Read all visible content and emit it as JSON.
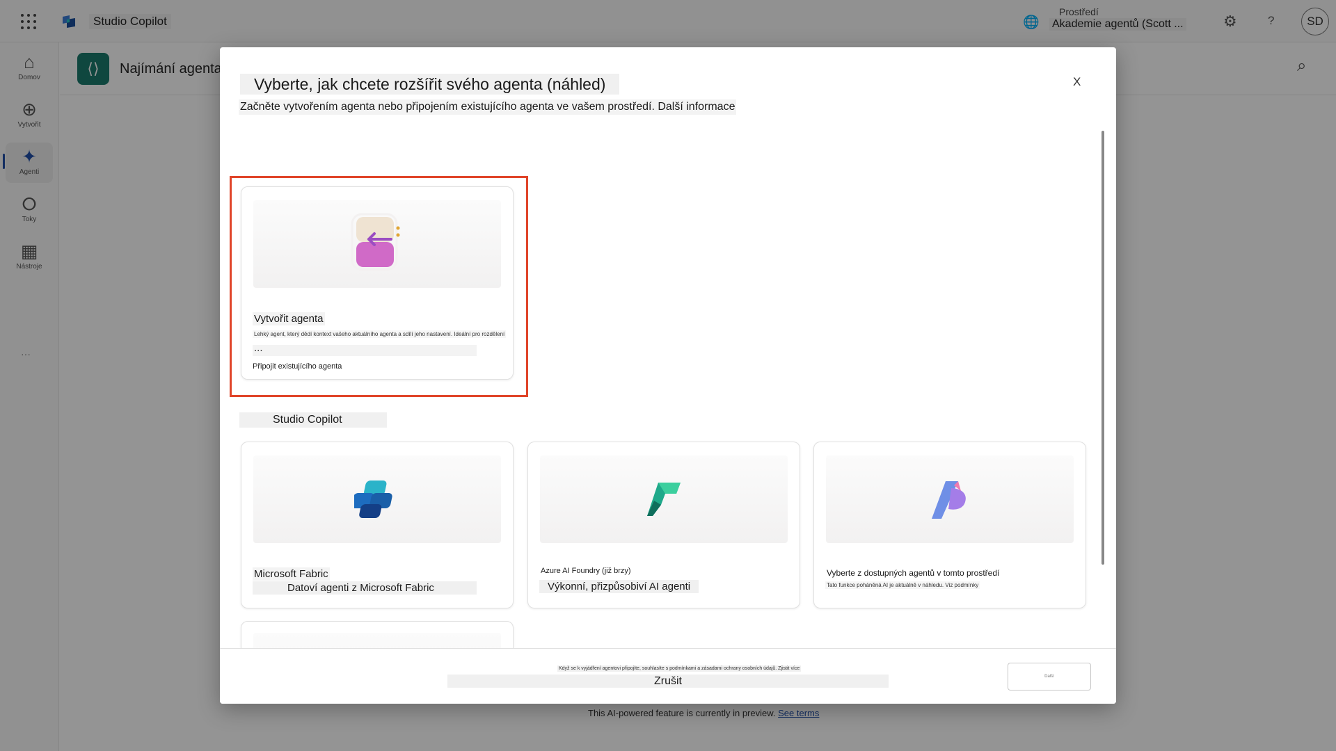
{
  "app": {
    "name": "Studio Copilot",
    "environment_label": "Prostředí",
    "environment_name": "Akademie agentů (Scott ...",
    "user_initials": "SD"
  },
  "nav": {
    "items": [
      {
        "label": "Domov",
        "icon": "home-icon"
      },
      {
        "label": "Vytvořit",
        "icon": "create-icon"
      },
      {
        "label": "Agenti",
        "icon": "agents-icon"
      },
      {
        "label": "Toky",
        "icon": "flows-icon"
      },
      {
        "label": "Nástroje",
        "icon": "tools-icon"
      }
    ],
    "more": "···"
  },
  "page": {
    "title": "Najímání agenta"
  },
  "dialog": {
    "title": "Vyberte, jak chcete rozšířit svého agenta (náhled)",
    "subtitle": "Začněte vytvořením agenta nebo připojením existujícího agenta ve vašem prostředí. Další informace",
    "close_label": "X",
    "create_card": {
      "title": "Vytvořit agenta",
      "description": "Lehký agent, který dědí kontext vašeho aktuálního agenta a sdílí jeho nastavení. Ideální pro rozdělení",
      "ellipsis": "...",
      "connect_label": "Připojit existujícího agenta"
    },
    "section_label": "Studio Copilot",
    "cards": [
      {
        "title": "Microsoft Fabric",
        "subtitle": "Datoví agenti z Microsoft Fabric"
      },
      {
        "title": "Azure AI Foundry (již brzy)",
        "subtitle": "Výkonní, přizpůsobiví AI agenti"
      },
      {
        "title": "Vyberte z dostupných agentů v tomto prostředí",
        "subtitle": "Tato funkce poháněná AI je aktuálně v náhledu. Viz podmínky"
      }
    ],
    "footer_note": "Když se k vyjádření agentovi připojíte, souhlasíte s podmínkami a zásadami ochrany osobních údajů. Zjistit více",
    "cancel_label": "Zrušit",
    "next_label": "Další"
  },
  "footer": {
    "text": "This AI-powered feature is currently in preview.",
    "link": "See terms"
  },
  "colors": {
    "highlight": "#e0452a",
    "accent": "#1f4fa8",
    "agent_badge": "#1b7a6d"
  }
}
